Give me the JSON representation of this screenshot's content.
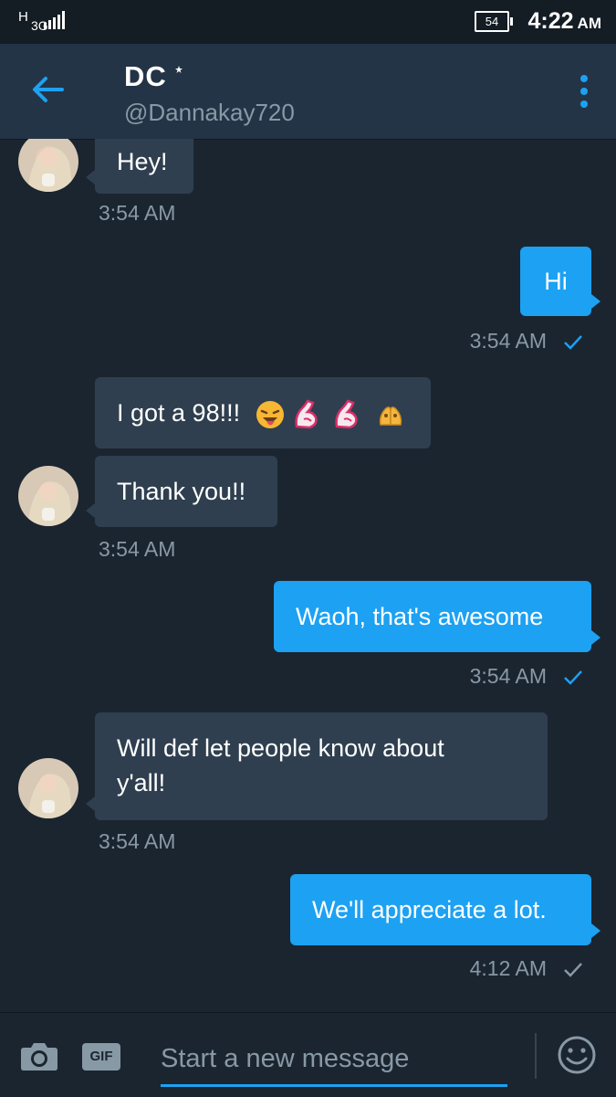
{
  "status_bar": {
    "network_h": "H",
    "network_type": "3G",
    "battery": "54",
    "time": "4:22",
    "ampm": "AM"
  },
  "header": {
    "contact_name": "DC",
    "contact_handle": "@Dannakay720",
    "back_icon": "arrow-left-icon",
    "more_icon": "more-vertical-icon"
  },
  "messages": [
    {
      "direction": "incoming",
      "text": "Hey!",
      "time": "3:54 AM"
    },
    {
      "direction": "outgoing",
      "text": "Hi",
      "time": "3:54 AM",
      "read": true
    },
    {
      "direction": "incoming",
      "text": "I got a 98!!!",
      "emojis": [
        "tongue-face",
        "flexed-biceps",
        "flexed-biceps",
        "praying-hands"
      ]
    },
    {
      "direction": "incoming",
      "text": "Thank you!!",
      "time": "3:54 AM"
    },
    {
      "direction": "outgoing",
      "text": "Waoh, that's awesome",
      "time": "3:54 AM",
      "read": true
    },
    {
      "direction": "incoming",
      "text_line1": "Will def let people know about",
      "text_line2": "y'all!",
      "time": "3:54 AM"
    },
    {
      "direction": "outgoing",
      "text": "We'll appreciate a lot.",
      "time": "4:12 AM",
      "read": false
    }
  ],
  "composer": {
    "placeholder": "Start a new message",
    "gif_label": "GIF",
    "camera_icon": "camera-icon",
    "emoji_icon": "smiley-icon"
  },
  "colors": {
    "background": "#1b2530",
    "header": "#243447",
    "incoming_bubble": "#2f3f4f",
    "outgoing_bubble": "#1da1f2",
    "muted_text": "#8899a6",
    "accent": "#1da1f2"
  }
}
